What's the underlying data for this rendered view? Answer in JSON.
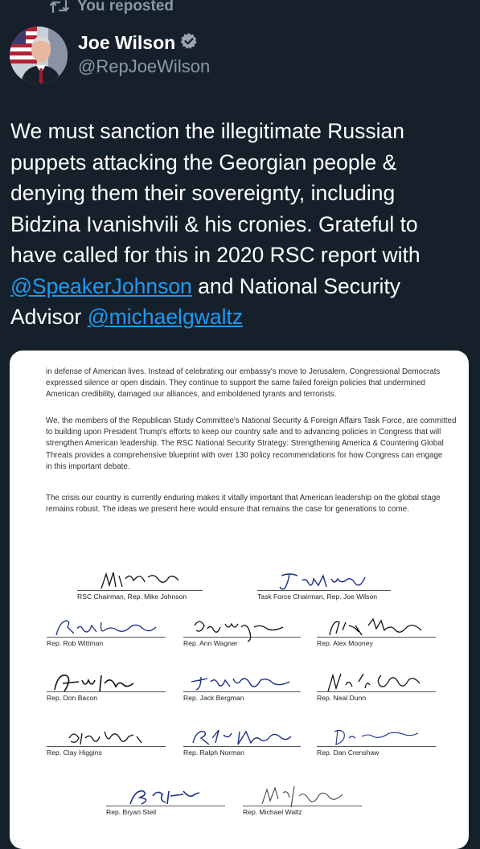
{
  "repost": {
    "label": "You reposted",
    "icon": "repost-icon"
  },
  "author": {
    "name": "Joe Wilson",
    "handle": "@RepJoeWilson",
    "verified_icon": "verified-badge-icon",
    "avatar_icon": "avatar"
  },
  "tweet": {
    "lines": [
      "We must sanction the illegitimate Russian",
      "puppets attacking the Georgian people &",
      "denying them their sovereignty, including",
      "Bidzina Ivanishvili & his cronies. Grateful to",
      "have called for this in 2020 RSC report with"
    ],
    "mention_1": "@SpeakerJohnson",
    "after_mention_1": " and National Security",
    "advisor_text": "Advisor ",
    "mention_2": "@michaelgwaltz"
  },
  "document": {
    "para_1": [
      "in defense of American lives. Instead of celebrating our embassy's move to Jerusalem, Congressional Democrats",
      "expressed silence or open disdain. They continue to support the same failed foreign policies that undermined",
      "American credibility, damaged our alliances, and emboldened tyrants and terrorists."
    ],
    "para_2": [
      "We, the members of the Republican Study Committee's National Security & Foreign Affairs Task Force, are committed",
      "to building upon President Trump's efforts to keep our country safe and to advancing policies in Congress that will",
      "strengthen American leadership. The RSC National Security Strategy: Strengthening America & Countering Global",
      "Threats provides a comprehensive blueprint with over 130 policy recommendations for how Congress can engage",
      "in this important debate."
    ],
    "para_3": [
      "The crisis our country is currently enduring makes it vitally important that American leadership on the global stage",
      "remains robust. The ideas we present here would ensure that remains the case for generations to come."
    ],
    "signatures": {
      "johnson": "RSC Chairman, Rep. Mike Johnson",
      "wilson": "Task Force Chairman, Rep. Joe Wilson",
      "wittman": "Rep. Rob Wittman",
      "wagner": "Rep. Ann Wagner",
      "mooney": "Rep. Alex Mooney",
      "bacon": "Rep. Don Bacon",
      "bergman": "Rep. Jack Bergman",
      "dunn": "Rep. Neal Dunn",
      "higgins": "Rep. Clay Higgins",
      "norman": "Rep. Ralph Norman",
      "crenshaw": "Rep. Dan Crenshaw",
      "steil": "Rep. Bryan Steil",
      "waltz": "Rep. Michael Waltz"
    }
  },
  "colors": {
    "background": "#15202b",
    "text_primary": "#ffffff",
    "text_secondary": "#8b98a5",
    "link": "#1d9bf0",
    "signature_ink": "#1a2f8a"
  }
}
